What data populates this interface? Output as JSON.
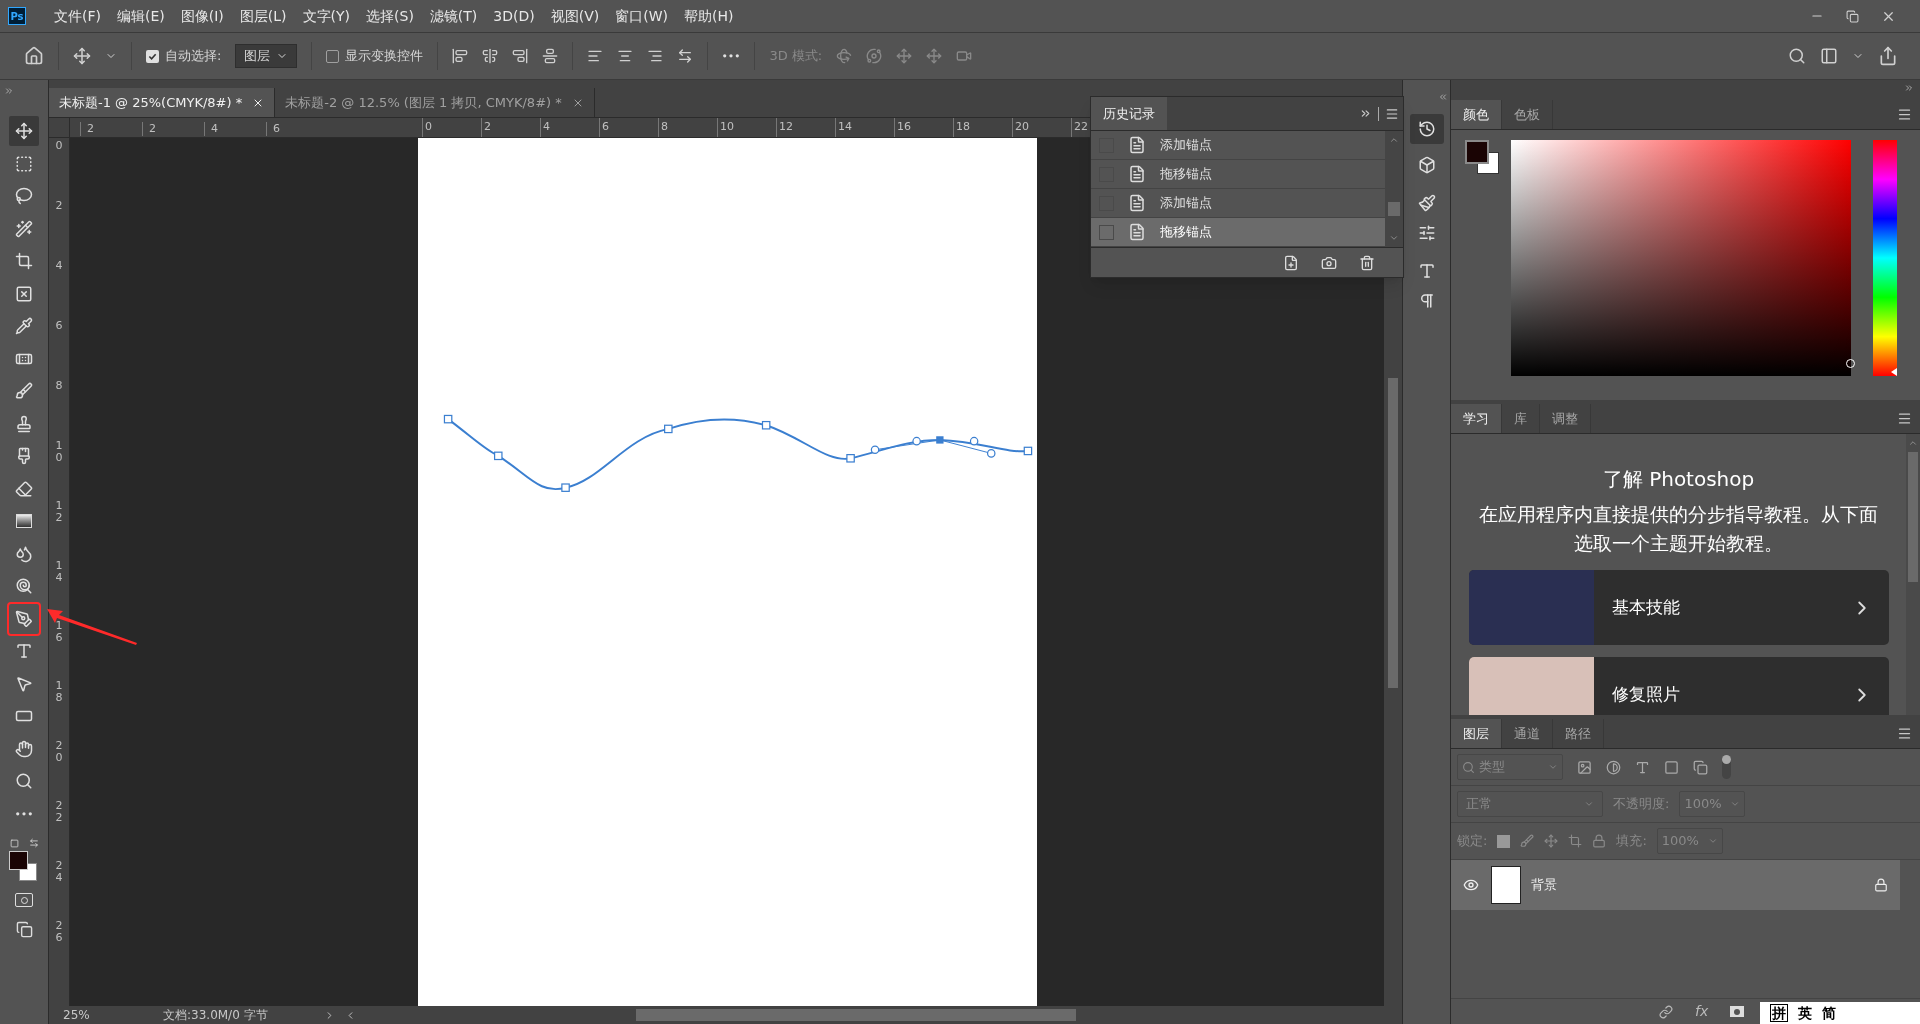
{
  "app_icon": "Ps",
  "menu": [
    "文件(F)",
    "编辑(E)",
    "图像(I)",
    "图层(L)",
    "文字(Y)",
    "选择(S)",
    "滤镜(T)",
    "3D(D)",
    "视图(V)",
    "窗口(W)",
    "帮助(H)"
  ],
  "options_bar": {
    "auto_select": {
      "label": "自动选择:",
      "checked": true
    },
    "layer_dropdown": "图层",
    "transform_controls": {
      "label": "显示变换控件",
      "checked": false
    },
    "mode_3d_label": "3D 模式:"
  },
  "toolbar": {
    "tools": [
      {
        "selected": true,
        "annotated": false
      },
      {
        "selected": false,
        "annotated": false
      },
      {
        "selected": false,
        "annotated": false
      },
      {
        "selected": false,
        "annotated": false
      },
      {
        "selected": false,
        "annotated": false
      },
      {
        "selected": false,
        "annotated": false
      },
      {
        "selected": false,
        "annotated": false
      },
      {
        "selected": false,
        "annotated": false
      },
      {
        "selected": false,
        "annotated": false
      },
      {
        "selected": false,
        "annotated": false
      },
      {
        "selected": false,
        "annotated": false
      },
      {
        "selected": false,
        "annotated": false
      },
      {
        "selected": false,
        "annotated": false
      },
      {
        "selected": false,
        "annotated": false
      },
      {
        "selected": false,
        "annotated": false
      },
      {
        "selected": false,
        "annotated": true
      },
      {
        "selected": false,
        "annotated": false
      },
      {
        "selected": false,
        "annotated": false
      },
      {
        "selected": false,
        "annotated": false
      },
      {
        "selected": false,
        "annotated": false
      },
      {
        "selected": false,
        "annotated": false
      },
      {
        "selected": false,
        "annotated": false
      }
    ]
  },
  "document_tabs": [
    {
      "title": "未标题-1 @ 25%(CMYK/8#) *",
      "selected": true
    },
    {
      "title": "未标题-2 @ 12.5% (图层 1 拷贝, CMYK/8#) *",
      "selected": false
    }
  ],
  "ruler_h": {
    "before_zero": [
      "2",
      "2",
      "4",
      "6"
    ],
    "labels": [
      "0",
      "2",
      "4",
      "6",
      "8",
      "10",
      "12",
      "14",
      "16",
      "18",
      "20",
      "22"
    ]
  },
  "ruler_v": {
    "labels": [
      "0",
      "2",
      "4",
      "6",
      "8",
      "10",
      "12",
      "14",
      "16",
      "18",
      "20",
      "22",
      "24",
      "26"
    ]
  },
  "history_panel": {
    "tab": "历史记录",
    "items": [
      {
        "label": "添加锚点",
        "selected": false
      },
      {
        "label": "拖移锚点",
        "selected": false
      },
      {
        "label": "添加锚点",
        "selected": false
      },
      {
        "label": "拖移锚点",
        "selected": true
      }
    ]
  },
  "color_panel": {
    "tabs": [
      {
        "label": "颜色",
        "selected": true
      },
      {
        "label": "色板",
        "selected": false
      }
    ],
    "hue": {
      "level": 0
    }
  },
  "learn_panel": {
    "tabs": [
      {
        "label": "学习",
        "selected": true
      },
      {
        "label": "库",
        "selected": false
      },
      {
        "label": "调整",
        "selected": false
      }
    ],
    "title": "了解 Photoshop",
    "description": "在应用程序内直接提供的分步指导教程。从下面选取一个主题开始教程。",
    "tutorials": [
      {
        "label": "基本技能"
      },
      {
        "label": "修复照片"
      }
    ]
  },
  "layers_panel": {
    "tabs": [
      {
        "label": "图层",
        "selected": true
      },
      {
        "label": "通道",
        "selected": false
      },
      {
        "label": "路径",
        "selected": false
      }
    ],
    "filter_placeholder": "类型",
    "blend_mode": "正常",
    "opacity_label": "不透明度:",
    "opacity": "100%",
    "lock_label": "锁定:",
    "fill_label": "填充:",
    "fill": "100%",
    "layers": [
      {
        "name": "背景",
        "visible": true,
        "locked": true,
        "selected": true
      }
    ],
    "footer_fx": "fx"
  },
  "status_bar": {
    "zoom": "25%",
    "doc_info": "文档:33.0M/0 字节"
  },
  "ime_bar": {
    "items": [
      "拼",
      "英",
      "简"
    ]
  }
}
